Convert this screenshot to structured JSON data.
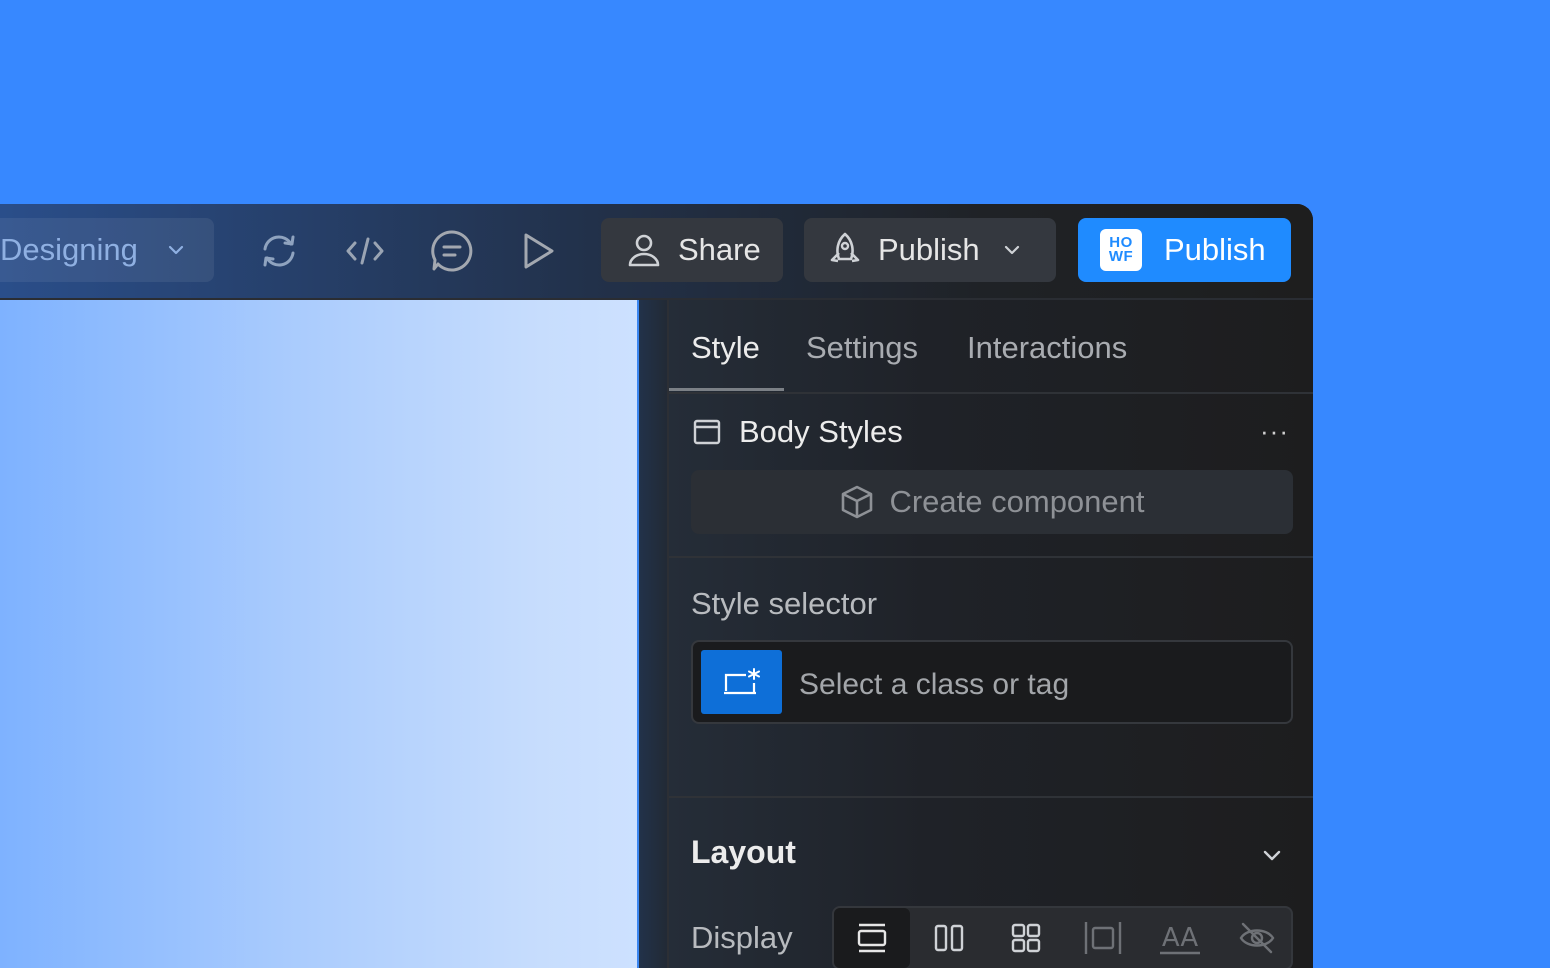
{
  "topbar": {
    "mode_label": "Designing",
    "icons": [
      "sync-icon",
      "code-icon",
      "comment-icon",
      "preview-play-icon"
    ],
    "share_label": "Share",
    "publish_dropdown_label": "Publish",
    "publish_button_label": "Publish",
    "logo_line1": "HO",
    "logo_line2": "WF"
  },
  "panel": {
    "tabs": [
      {
        "label": "Style",
        "active": true
      },
      {
        "label": "Settings",
        "active": false
      },
      {
        "label": "Interactions",
        "active": false
      }
    ],
    "element_name": "Body Styles",
    "more_label": "···",
    "create_component_label": "Create component",
    "style_selector_label": "Style selector",
    "style_selector_placeholder": "Select a class or tag",
    "layout_title": "Layout",
    "display_label": "Display",
    "display_options": [
      "block-icon",
      "flex-icon",
      "grid-icon",
      "inline-block-icon",
      "inline-text-icon",
      "hidden-icon"
    ],
    "display_text_option": "AA"
  },
  "colors": {
    "background": "#3788ff",
    "accent": "#1f8bff",
    "selector_tag": "#0e6fd8",
    "panel": "#1e1e1e"
  }
}
